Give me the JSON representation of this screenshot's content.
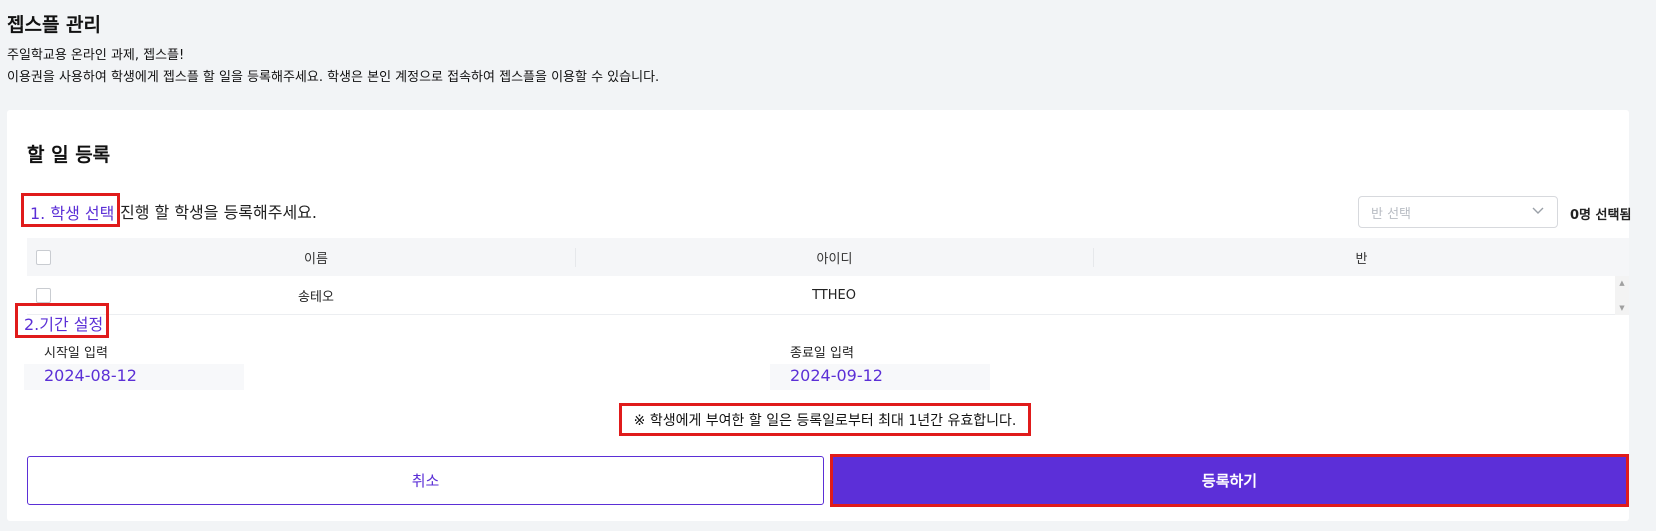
{
  "header": {
    "title": "젭스플 관리",
    "intro_line1": "주일학교용 온라인 과제, 젭스플!",
    "intro_line2": "이용권을 사용하여 학생에게 젭스플 할 일을 등록해주세요. 학생은 본인 계정으로 접속하여 젭스플을 이용할 수 있습니다."
  },
  "card": {
    "title": "할 일 등록",
    "step1": {
      "label": "1. 학생 선택",
      "description": "진행 할 학생을 등록해주세요.",
      "class_select_placeholder": "반 선택",
      "selected_count": "0명 선택됨"
    },
    "table": {
      "columns": [
        "이름",
        "아이디",
        "반"
      ],
      "rows": [
        {
          "name": "송테오",
          "id": "TTHEO",
          "class": ""
        }
      ]
    },
    "step2": {
      "label": "2.기간 설정",
      "start_label": "시작일 입력",
      "start_value": "2024-08-12",
      "end_label": "종료일 입력",
      "end_value": "2024-09-12"
    },
    "notice": "※ 학생에게 부여한 할 일은 등록일로부터 최대 1년간 유효합니다.",
    "buttons": {
      "cancel": "취소",
      "submit": "등록하기"
    }
  },
  "colors": {
    "accent": "#5c2fd8",
    "highlight_box": "#e01b1b",
    "page_bg": "#f2f4f6"
  },
  "icons": {
    "class_select_toggle": "chevron-down-icon",
    "scroll_up": "scroll-up-arrow-icon",
    "scroll_down": "scroll-down-arrow-icon"
  }
}
